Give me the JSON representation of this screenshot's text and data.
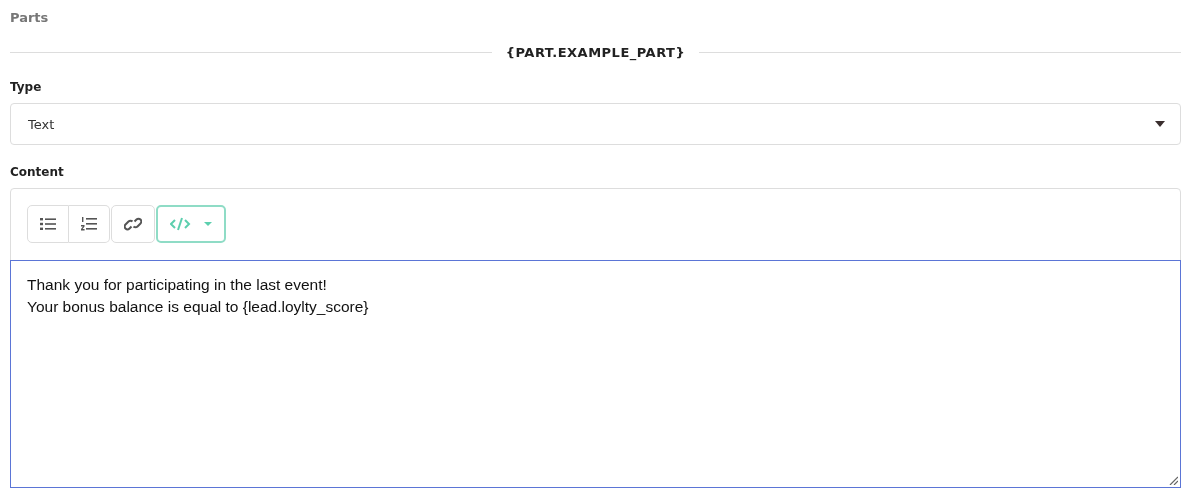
{
  "section_title": "Parts",
  "divider_label": "{PART.EXAMPLE_PART}",
  "type_field": {
    "label": "Type",
    "value": "Text"
  },
  "content_field": {
    "label": "Content",
    "toolbar": [
      {
        "kind": "bullet-list",
        "selected": false
      },
      {
        "kind": "numbered-list",
        "selected": false
      },
      {
        "kind": "link",
        "selected": false
      },
      {
        "kind": "code",
        "selected": true
      }
    ],
    "lines": [
      "Thank you for participating in the last event!",
      "Your bonus balance is equal to {lead.loylty_score}"
    ]
  }
}
